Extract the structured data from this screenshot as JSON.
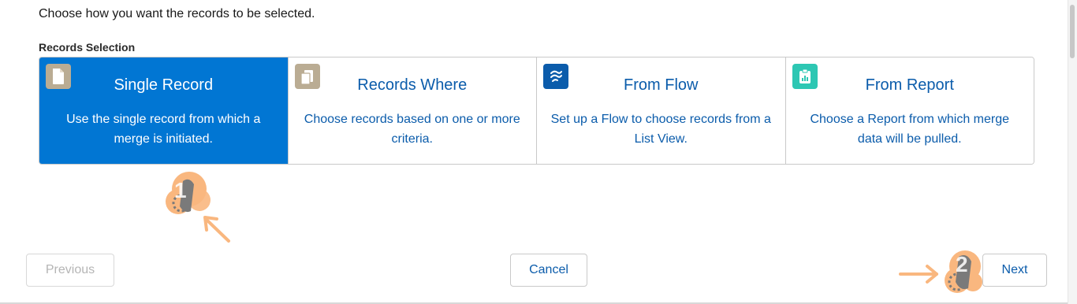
{
  "instruction": "Choose how you want the records to be selected.",
  "section_label": "Records Selection",
  "options": [
    {
      "title": "Single Record",
      "description": "Use the single record from which a merge is initiated.",
      "icon": "document-icon",
      "icon_color": "#baac93",
      "selected": true
    },
    {
      "title": "Records Where",
      "description": "Choose records based on one or more criteria.",
      "icon": "copy-documents-icon",
      "icon_color": "#baac93",
      "selected": false
    },
    {
      "title": "From Flow",
      "description": "Set up a Flow to choose records from a List View.",
      "icon": "flow-icon",
      "icon_color": "#0b5cab",
      "selected": false
    },
    {
      "title": "From Report",
      "description": "Choose a Report from which merge data will be pulled.",
      "icon": "report-icon",
      "icon_color": "#2dc7b3",
      "selected": false
    }
  ],
  "buttons": {
    "previous": "Previous",
    "cancel": "Cancel",
    "next": "Next"
  },
  "annotations": {
    "step1": "1",
    "step2": "2",
    "marker_color": "#f9b77f"
  },
  "colors": {
    "selected_bg": "#0176d3",
    "link_text": "#0b5cab"
  }
}
